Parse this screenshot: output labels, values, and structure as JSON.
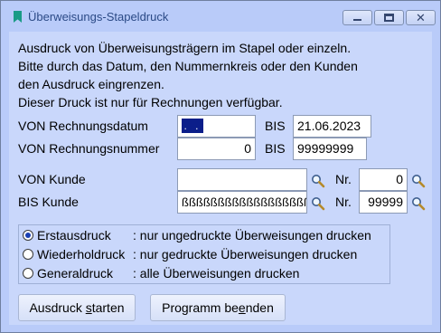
{
  "window": {
    "title": "Überweisungs-Stapeldruck"
  },
  "intro": {
    "lines": [
      "Ausdruck von Überweisungsträgern im Stapel oder einzeln.",
      "Bitte durch das Datum, den Nummernkreis oder den Kunden",
      "den Ausdruck eingrenzen.",
      "Dieser Druck ist nur für Rechnungen verfügbar."
    ]
  },
  "filters": {
    "von_rechnungsdatum_label": "VON Rechnungsdatum",
    "von_rechnungsdatum_value": ". .",
    "bis_label_1": "BIS",
    "bis_rechnungsdatum_value": "21.06.2023",
    "von_rechnungsnummer_label": "VON Rechnungsnummer",
    "von_rechnungsnummer_value": "0",
    "bis_label_2": "BIS",
    "bis_rechnungsnummer_value": "99999999",
    "von_kunde_label": "VON Kunde",
    "von_kunde_value": "",
    "nr_label_1": "Nr.",
    "von_kunde_nr_value": "0",
    "bis_kunde_label": "BIS Kunde",
    "bis_kunde_value": "ßßßßßßßßßßßßßßßßßßßß",
    "nr_label_2": "Nr.",
    "bis_kunde_nr_value": "99999"
  },
  "print_mode": {
    "selected": "erstausdruck",
    "options": [
      {
        "name": "Erstausdruck",
        "desc": ": nur ungedruckte Überweisungen drucken"
      },
      {
        "name": "Wiederholdruck",
        "desc": ": nur gedruckte Überweisungen drucken"
      },
      {
        "name": "Generaldruck",
        "desc": ": alle Überweisungen drucken"
      }
    ]
  },
  "buttons": {
    "start_pre": "Ausdruck ",
    "start_u": "s",
    "start_post": "tarten",
    "end_pre": "Programm be",
    "end_u": "e",
    "end_post": "nden"
  },
  "colors": {
    "window_bg": "#b9cbf9",
    "client_bg": "#c9d7fb",
    "selection": "#0b1e8a",
    "icon_accent": "#1a9b86"
  }
}
